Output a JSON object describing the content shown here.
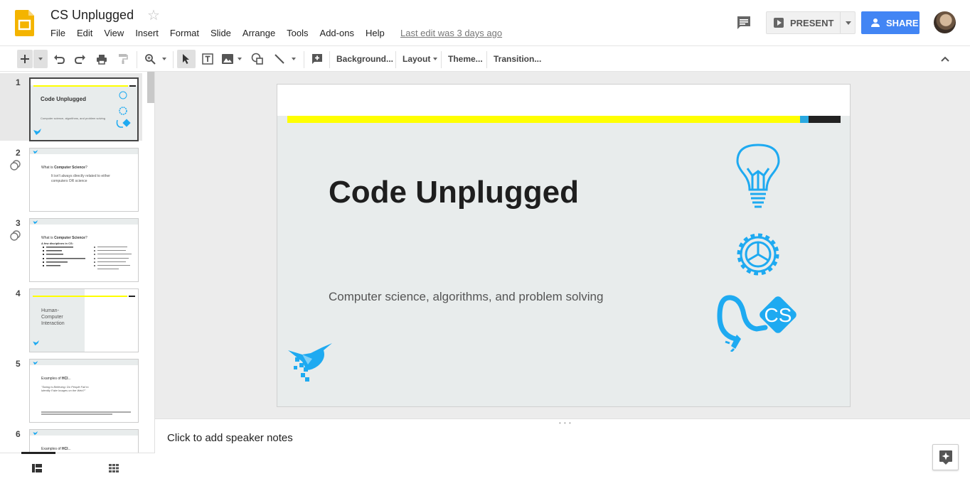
{
  "app": {
    "name": "Google Slides",
    "brand_color": "#f4b400"
  },
  "document": {
    "title": "CS Unplugged",
    "last_edit": "Last edit was 3 days ago"
  },
  "menu": [
    "File",
    "Edit",
    "View",
    "Insert",
    "Format",
    "Slide",
    "Arrange",
    "Tools",
    "Add-ons",
    "Help"
  ],
  "header": {
    "present_label": "PRESENT",
    "share_label": "SHARE",
    "share_color": "#4285f4"
  },
  "toolbar": {
    "background": "Background...",
    "layout": "Layout",
    "theme": "Theme...",
    "transition": "Transition..."
  },
  "slides": [
    {
      "num": "1",
      "title": "Code Unplugged",
      "subtitle": "Computer science, algorithms, and problem solving",
      "active": true
    },
    {
      "num": "2",
      "line1_pre": "What is ",
      "line1_bold": "Computer Science",
      "line1_post": "?",
      "body": "It isn't always directly related to either computers OR science",
      "linked": true
    },
    {
      "num": "3",
      "line1_pre": "What is ",
      "line1_bold": "Computer Science",
      "line1_post": "?",
      "body": "A few disciplines in CS:",
      "linked": true
    },
    {
      "num": "4",
      "title": "Human-Computer Interaction"
    },
    {
      "num": "5",
      "line1_pre": "Examples of ",
      "line1_bold": "HCI",
      "line1_post": "...",
      "body": "\"Swing is Believing: Do People Fail to Identify Fake Images on the Web?\""
    },
    {
      "num": "6",
      "line1_pre": "Examples of ",
      "line1_bold": "HCI",
      "line1_post": "..."
    }
  ],
  "main_slide": {
    "title": "Code Unplugged",
    "subtitle": "Computer science, algorithms, and problem solving",
    "accent_yellow": "#ffff00",
    "accent_blue": "#29a8e0",
    "icon_color": "#1eaaf1",
    "icons": [
      "lightbulb-icon",
      "gear-icon",
      "cs-plug-icon",
      "hummingbird-logo"
    ],
    "badge_text": "CS"
  },
  "notes": {
    "placeholder": "Click to add speaker notes"
  }
}
